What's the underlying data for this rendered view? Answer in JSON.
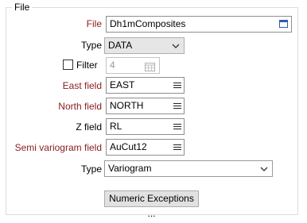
{
  "group": {
    "title": "File"
  },
  "fields": {
    "file": {
      "label": "File",
      "value": "Dh1mComposites"
    },
    "type1": {
      "label": "Type",
      "value": "DATA"
    },
    "filter": {
      "label": "Filter",
      "value": "4"
    },
    "east": {
      "label": "East field",
      "value": "EAST"
    },
    "north": {
      "label": "North field",
      "value": "NORTH"
    },
    "z": {
      "label": "Z field",
      "value": "RL"
    },
    "semi": {
      "label": "Semi variogram field",
      "value": "AuCut12"
    },
    "type2": {
      "label": "Type",
      "value": "Variogram"
    }
  },
  "buttons": {
    "numeric_exceptions": "Numeric Exceptions ..."
  },
  "colors": {
    "required_label": "#8b1c1c",
    "disabled_text": "#9a9a9a",
    "icon_blue": "#2d5fa6"
  },
  "icons": {
    "file_browse": "window-icon",
    "list_picker": "hamburger-icon",
    "dropdown": "chevron-down-icon",
    "filter_picker": "calendar-grid-icon"
  }
}
